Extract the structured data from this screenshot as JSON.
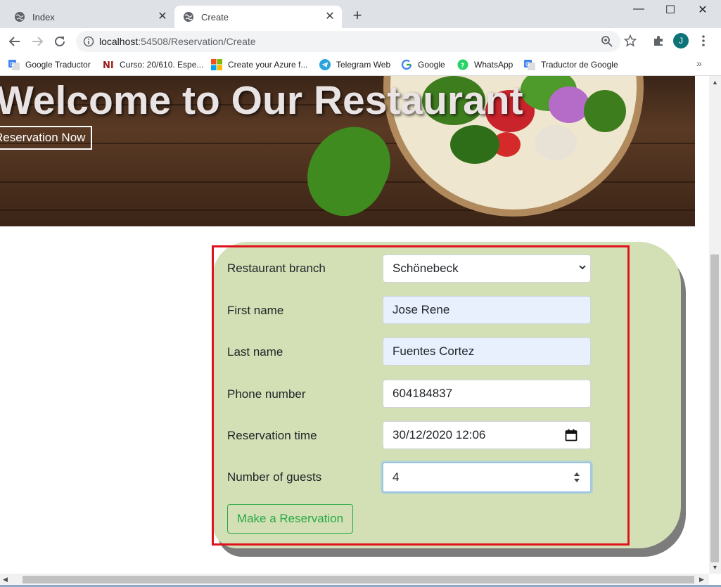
{
  "tabs": [
    {
      "label": "Index"
    },
    {
      "label": "Create"
    }
  ],
  "window_controls": {
    "minimize": "—",
    "maximize": "☐",
    "close": "✕"
  },
  "address_bar": {
    "host": "localhost",
    "rest": ":54508/Reservation/Create"
  },
  "avatar_letter": "J",
  "bookmarks": [
    {
      "label": "Google Traductor",
      "icon": "google-translate-icon"
    },
    {
      "label": "Curso: 20/610. Espe...",
      "icon": "ni-icon"
    },
    {
      "label": "Create your Azure f...",
      "icon": "microsoft-icon"
    },
    {
      "label": "Telegram Web",
      "icon": "telegram-icon"
    },
    {
      "label": "Google",
      "icon": "google-icon"
    },
    {
      "label": "WhatsApp",
      "icon": "whatsapp-icon"
    },
    {
      "label": "Traductor de Google",
      "icon": "google-translate-icon"
    }
  ],
  "hero": {
    "title": "Welcome to Our Restaurant",
    "button": "Reservation Now"
  },
  "form": {
    "branch_label": "Restaurant branch",
    "branch_value": "Schönebeck",
    "first_name_label": "First name",
    "first_name_value": "Jose Rene",
    "last_name_label": "Last name",
    "last_name_value": "Fuentes Cortez",
    "phone_label": "Phone number",
    "phone_value": "604184837",
    "time_label": "Reservation time",
    "time_value": "30/12/2020 12:06",
    "guests_label": "Number of guests",
    "guests_value": "4",
    "submit_label": "Make a Reservation"
  },
  "colors": {
    "card_bg": "#d3e0b5",
    "highlight_border": "#e0131d",
    "submit_green": "#28a745"
  }
}
